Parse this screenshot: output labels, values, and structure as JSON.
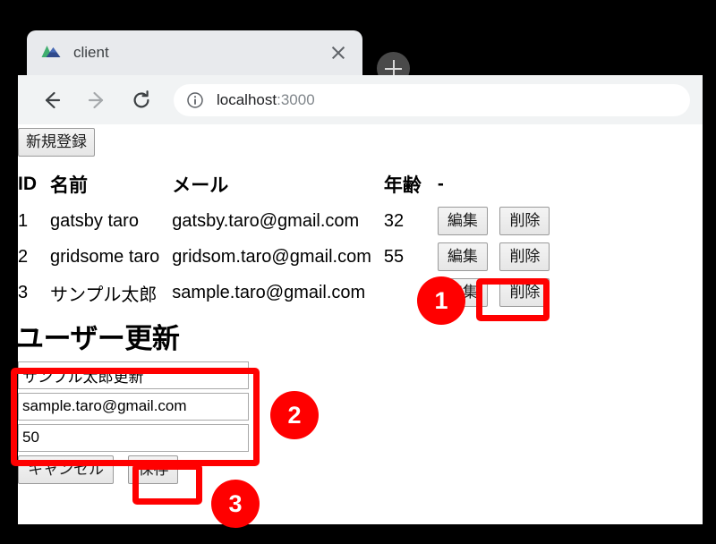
{
  "browser": {
    "tab": {
      "title": "client",
      "favicon": "mountain-logo-icon",
      "close_label": "×"
    },
    "new_tab_label": "+",
    "nav": {
      "back_label": "←",
      "forward_label": "→",
      "reload_label": "⟳"
    },
    "omnibox": {
      "info_icon": "info-circle-icon",
      "url_host": "localhost",
      "url_port": ":3000"
    }
  },
  "page": {
    "new_register_button": "新規登録",
    "table": {
      "headers": [
        "ID",
        "名前",
        "メール",
        "年齢",
        "-"
      ],
      "rows": [
        {
          "id": "1",
          "name": "gatsby taro",
          "email": "gatsby.taro@gmail.com",
          "age": "32",
          "edit_label": "編集",
          "delete_label": "削除"
        },
        {
          "id": "2",
          "name": "gridsome taro",
          "email": "gridsom.taro@gmail.com",
          "age": "55",
          "edit_label": "編集",
          "delete_label": "削除"
        },
        {
          "id": "3",
          "name": "サンプル太郎",
          "email": "sample.taro@gmail.com",
          "age": "",
          "edit_label": "編集",
          "delete_label": "削除"
        }
      ]
    },
    "form": {
      "title": "ユーザー更新",
      "name_value": "サンプル太郎更新",
      "email_value": "sample.taro@gmail.com",
      "age_value": "50",
      "cancel_label": "キャンセル",
      "save_label": "保存"
    }
  },
  "annotations": {
    "accent_color": "#ff0000",
    "steps": [
      {
        "number": "1",
        "target": "edit-button-row-3"
      },
      {
        "number": "2",
        "target": "user-update-form-fields"
      },
      {
        "number": "3",
        "target": "save-button"
      }
    ]
  }
}
